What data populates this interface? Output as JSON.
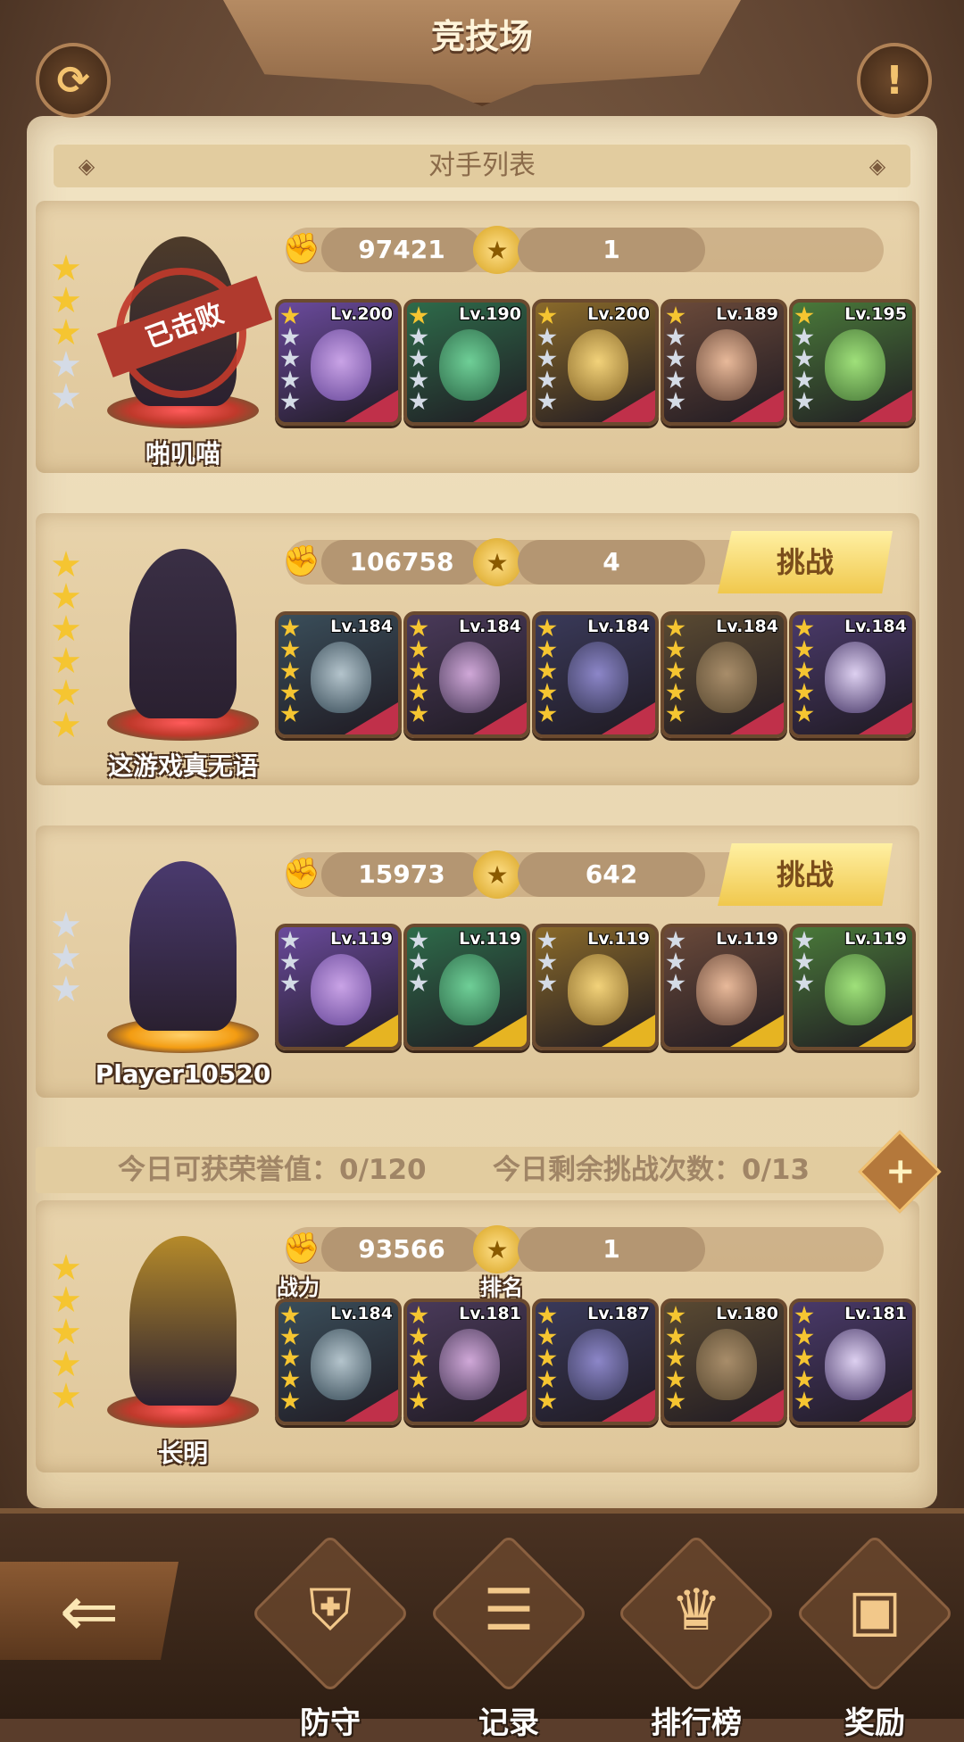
{
  "header": {
    "title": "竞技场"
  },
  "icons": {
    "refresh": "refresh-icon",
    "info": "exclamation-icon",
    "back": "back-arrow-icon",
    "power": "fist-icon",
    "rank": "medal-icon",
    "plus": "plus-icon"
  },
  "section": {
    "title": "对手列表"
  },
  "labels": {
    "challenge": "挑战",
    "defeated": "已击败",
    "power": "战力",
    "rank": "排名"
  },
  "opponents": [
    {
      "name": "啪叽喵",
      "power": "97421",
      "rank": "1",
      "defeated": true,
      "stars_gold": 3,
      "stars_silver": 2,
      "heroes": [
        {
          "lv": "Lv.200"
        },
        {
          "lv": "Lv.190"
        },
        {
          "lv": "Lv.200"
        },
        {
          "lv": "Lv.189"
        },
        {
          "lv": "Lv.195"
        }
      ]
    },
    {
      "name": "这游戏真无语",
      "power": "106758",
      "rank": "4",
      "defeated": false,
      "stars_gold": 6,
      "stars_silver": 0,
      "heroes": [
        {
          "lv": "Lv.184"
        },
        {
          "lv": "Lv.184"
        },
        {
          "lv": "Lv.184"
        },
        {
          "lv": "Lv.184"
        },
        {
          "lv": "Lv.184"
        }
      ]
    },
    {
      "name": "Player10520",
      "power": "15973",
      "rank": "642",
      "defeated": false,
      "stars_gold": 0,
      "stars_silver": 3,
      "heroes": [
        {
          "lv": "Lv.119"
        },
        {
          "lv": "Lv.119"
        },
        {
          "lv": "Lv.119"
        },
        {
          "lv": "Lv.119"
        },
        {
          "lv": "Lv.119"
        }
      ]
    }
  ],
  "info_bar": {
    "honor": "今日可获荣誉值：0/120",
    "challenges": "今日剩余挑战次数：0/13"
  },
  "self": {
    "name": "长明",
    "power": "93566",
    "rank": "1",
    "stars_gold": 5,
    "stars_silver": 0,
    "heroes": [
      {
        "lv": "Lv.184"
      },
      {
        "lv": "Lv.181"
      },
      {
        "lv": "Lv.187"
      },
      {
        "lv": "Lv.180"
      },
      {
        "lv": "Lv.181"
      }
    ]
  },
  "nav": [
    {
      "label": "防守",
      "icon": "shield-icon"
    },
    {
      "label": "记录",
      "icon": "scroll-icon"
    },
    {
      "label": "排行榜",
      "icon": "trophy-icon"
    },
    {
      "label": "奖励",
      "icon": "treasure-chest-icon"
    }
  ],
  "colors": {
    "accent": "#f5c531",
    "defeat": "#c0392b",
    "panel": "#e8d3ab",
    "challenge": "#f0c84d"
  }
}
